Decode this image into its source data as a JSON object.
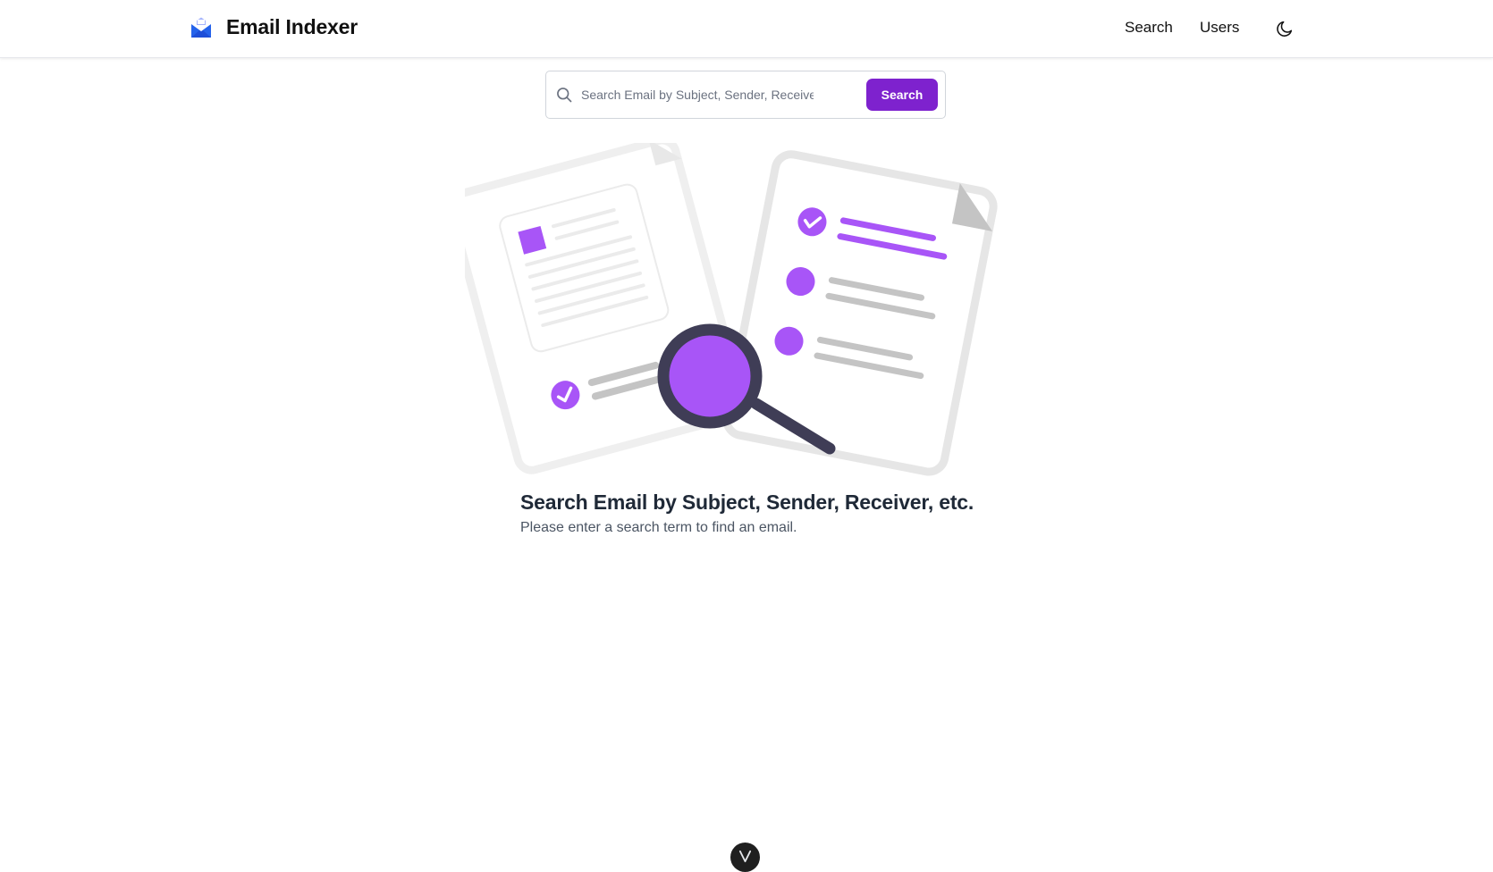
{
  "app": {
    "title": "Email Indexer"
  },
  "nav": {
    "items": [
      {
        "label": "Search"
      },
      {
        "label": "Users"
      }
    ],
    "theme_icon": "moon-icon"
  },
  "search": {
    "placeholder": "Search Email by Subject, Sender, Receiver, etc.",
    "value": "",
    "button_label": "Search",
    "icon": "search-icon"
  },
  "empty_state": {
    "title": "Search Email by Subject, Sender, Receiver, etc.",
    "subtitle": "Please enter a search term to find an email.",
    "illustration": "search-documents-illustration"
  },
  "footer": {
    "badge_icon": "v-logo-icon"
  },
  "colors": {
    "accent": "#7e22ce",
    "illustration_accent": "#a855f7",
    "brand_icon": "#2563eb",
    "magnifier": "#3f3d56"
  }
}
